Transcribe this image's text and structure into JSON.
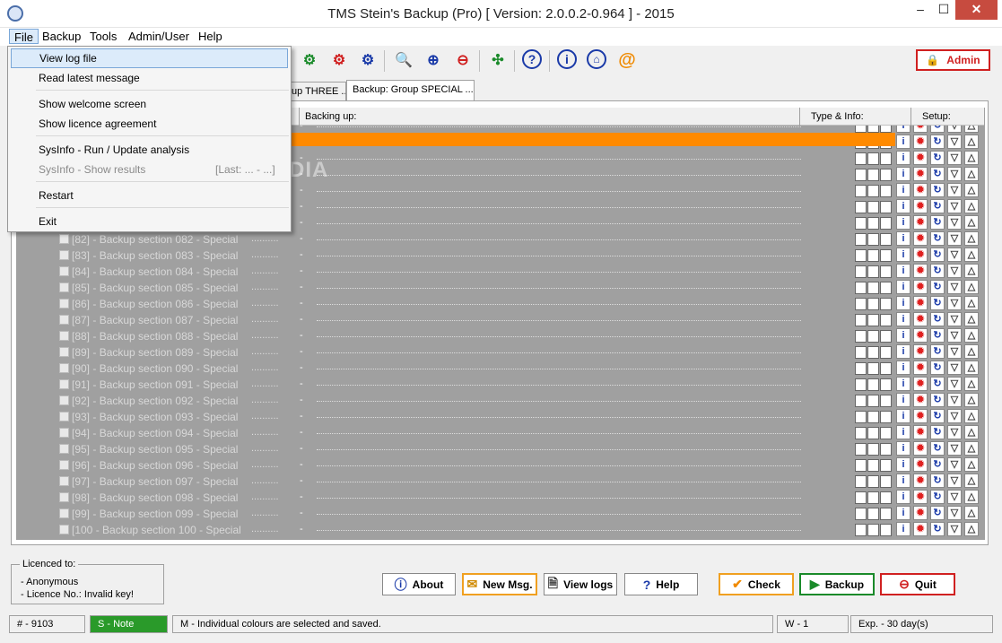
{
  "window": {
    "title": "TMS Stein's Backup (Pro) [ Version: 2.0.0.2-0.964 ] - 2015",
    "min": "–",
    "max": "☐",
    "close": "✕"
  },
  "menu": {
    "items": [
      "File",
      "Backup",
      "Tools",
      "Admin/User",
      "Help"
    ]
  },
  "file_menu": {
    "items": [
      {
        "label": "View log file"
      },
      {
        "label": "Read latest message"
      },
      {
        "label": "Show welcome screen"
      },
      {
        "label": "Show licence agreement"
      },
      {
        "label": "SysInfo - Run / Update analysis"
      },
      {
        "label": "SysInfo - Show results",
        "extra": "[Last: ... - ...]",
        "disabled": true
      },
      {
        "label": "Restart"
      },
      {
        "label": "Exit"
      }
    ]
  },
  "toolbar": {
    "admin_label": "Admin",
    "colors": {
      "green": "#1a8a2a",
      "red": "#d02020",
      "blue": "#1a3aa8",
      "orange": "#f08a00"
    }
  },
  "tabs": [
    {
      "label": "up THREE ..."
    },
    {
      "label": "Backup: Group SPECIAL ..."
    }
  ],
  "grid": {
    "headers": {
      "backing_up": "Backing up:",
      "type_info": "Type & Info:",
      "setup": "Setup:"
    },
    "highlight_color": "#ff8a00",
    "rows": [
      {
        "num": "[82]",
        "name": "- Backup section 082 - Special"
      },
      {
        "num": "[83]",
        "name": "- Backup section 083 - Special"
      },
      {
        "num": "[84]",
        "name": "- Backup section 084 - Special"
      },
      {
        "num": "[85]",
        "name": "- Backup section 085 - Special"
      },
      {
        "num": "[86]",
        "name": "- Backup section 086 - Special"
      },
      {
        "num": "[87]",
        "name": "- Backup section 087 - Special"
      },
      {
        "num": "[88]",
        "name": "- Backup section 088 - Special"
      },
      {
        "num": "[89]",
        "name": "- Backup section 089 - Special"
      },
      {
        "num": "[90]",
        "name": "- Backup section 090 - Special"
      },
      {
        "num": "[91]",
        "name": "- Backup section 091 - Special"
      },
      {
        "num": "[92]",
        "name": "- Backup section 092 - Special"
      },
      {
        "num": "[93]",
        "name": "- Backup section 093 - Special"
      },
      {
        "num": "[94]",
        "name": "- Backup section 094 - Special"
      },
      {
        "num": "[95]",
        "name": "- Backup section 095 - Special"
      },
      {
        "num": "[96]",
        "name": "- Backup section 096 - Special"
      },
      {
        "num": "[97]",
        "name": "- Backup section 097 - Special"
      },
      {
        "num": "[98]",
        "name": "- Backup section 098 - Special"
      },
      {
        "num": "[99]",
        "name": "- Backup section 099 - Special"
      },
      {
        "num": "[100",
        "name": "- Backup section 100 - Special"
      }
    ],
    "dots": "..........",
    "dash": "-"
  },
  "watermark": "SOFTPEDIA",
  "licence": {
    "legend": "Licenced to:",
    "line1": "- Anonymous",
    "line2": "- Licence No.: Invalid key!"
  },
  "buttons": {
    "about": "About",
    "new_msg": "New Msg.",
    "view_logs": "View logs",
    "help": "Help",
    "check": "Check",
    "backup": "Backup",
    "quit": "Quit"
  },
  "status": {
    "count": "# - 9103",
    "note": "S - Note",
    "message": "M - Individual colours are selected and saved.",
    "w": "W - 1",
    "exp": "Exp. - 30 day(s)"
  }
}
